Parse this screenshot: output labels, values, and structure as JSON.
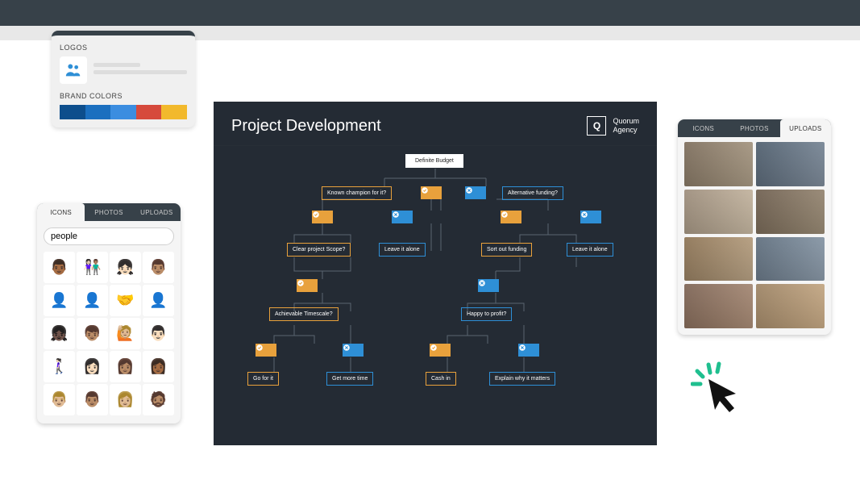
{
  "brandPanel": {
    "logosLabel": "LOGOS",
    "brandColorsLabel": "BRAND COLORS",
    "colors": [
      "#0d4e8c",
      "#1b6fbf",
      "#3b8de0",
      "#d64a3c",
      "#f2b92c"
    ]
  },
  "iconsPanel": {
    "tabs": [
      "ICONS",
      "PHOTOS",
      "UPLOADS"
    ],
    "activeTab": 0,
    "searchValue": "people",
    "icons": [
      "👨🏾",
      "👩🏻‍🤝‍👨🏽",
      "👧🏻",
      "👨🏽",
      "👤",
      "👤",
      "🤝",
      "👤",
      "👧🏿",
      "👦🏽",
      "🙋🏼",
      "👨🏻",
      "🚶🏻‍♀️",
      "👩🏻",
      "👩🏽",
      "👩🏾",
      "👨🏼",
      "👨🏽",
      "👩🏼",
      "🧔🏽"
    ]
  },
  "uploadsPanel": {
    "tabs": [
      "ICONS",
      "PHOTOS",
      "UPLOADS"
    ],
    "activeTab": 2,
    "photoCount": 8
  },
  "diagram": {
    "title": "Project Development",
    "brandInitial": "Q",
    "brandLine1": "Quorum",
    "brandLine2": "Agency",
    "nodes": {
      "start": "Definite Budget",
      "l1a": "Known champion for it?",
      "l1b": "Alternative funding?",
      "l2a": "Clear project Scope?",
      "l2b": "Leave it alone",
      "l2c": "Sort out funding",
      "l2d": "Leave it alone",
      "l3a": "Achievable Timescale?",
      "l3b": "Happy to profit?",
      "l4a": "Go for it",
      "l4b": "Get more time",
      "l4c": "Cash in",
      "l4d": "Explain why it matters"
    }
  }
}
